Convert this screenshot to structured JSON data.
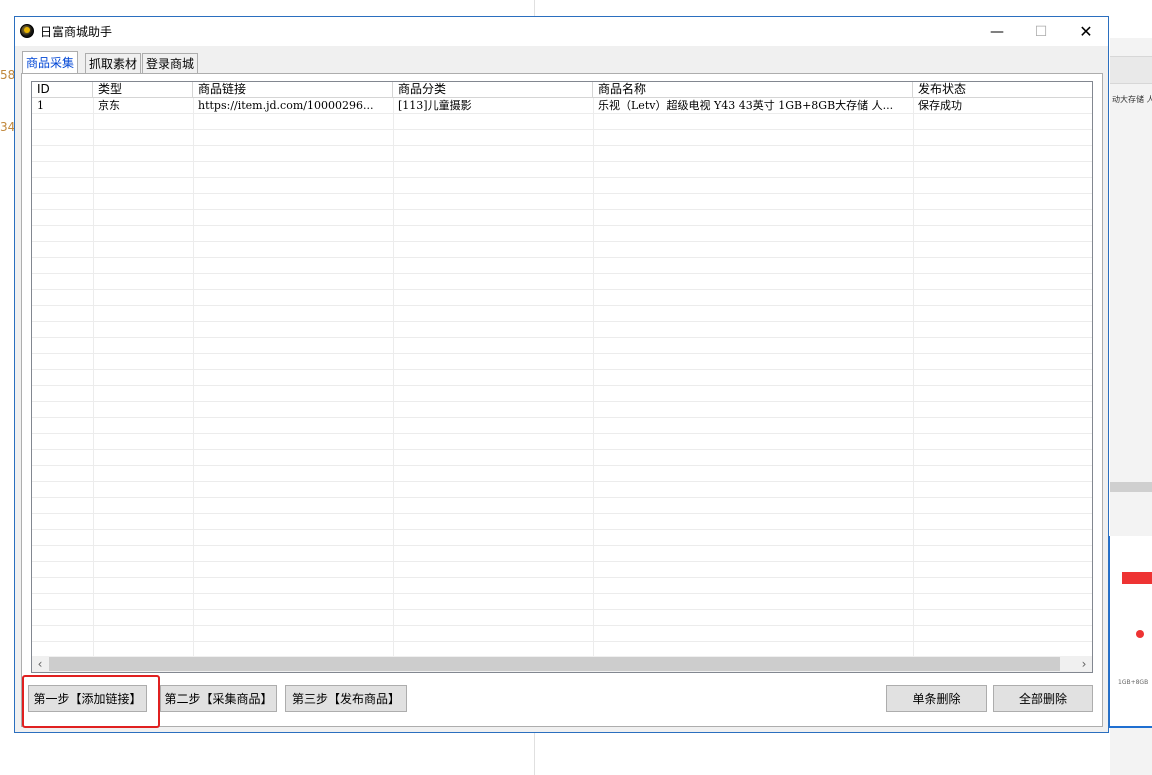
{
  "window": {
    "title": "日富商城助手"
  },
  "tabs": [
    {
      "label": "商品采集",
      "active": true
    },
    {
      "label": "抓取素材",
      "active": false
    },
    {
      "label": "登录商城",
      "active": false
    }
  ],
  "table": {
    "columns": [
      "ID",
      "类型",
      "商品链接",
      "商品分类",
      "商品名称",
      "发布状态"
    ],
    "rows": [
      [
        "1",
        "京东",
        "https://item.jd.com/10000296...",
        "[113]儿童摄影",
        "乐视（Letv）超级电视 Y43 43英寸 1GB+8GB大存储 人...",
        "保存成功"
      ]
    ]
  },
  "buttons": {
    "step1": "第一步【添加链接】",
    "step2": "第二步【采集商品】",
    "step3": "第三步【发布商品】",
    "delete_one": "单条删除",
    "delete_all": "全部删除"
  },
  "background": {
    "right_snippet": "动大存储 人",
    "left_num_1": "58.",
    "left_num_2": "34.",
    "mini_text_1": "1GB+8GB"
  },
  "colors": {
    "accent": "#0046d5",
    "window_border": "#2b6fbf",
    "highlight": "#e02020"
  }
}
